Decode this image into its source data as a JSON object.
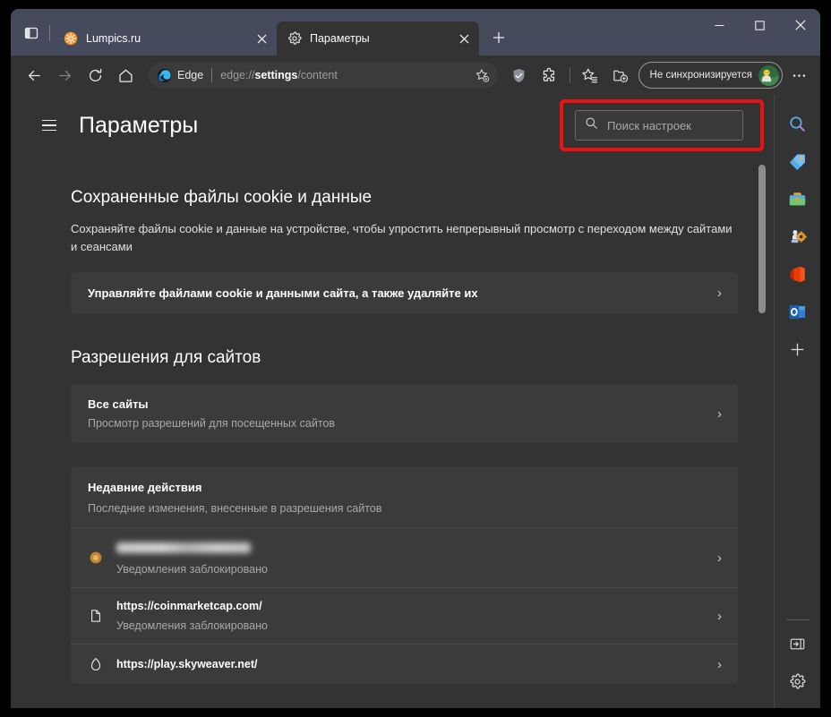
{
  "window": {
    "controls": {
      "minimize": "—",
      "maximize": "☐",
      "close": "✕"
    },
    "tab_actions_label": "Действия с вкладками",
    "new_tab_label": "Новая вкладка"
  },
  "tabs": [
    {
      "title": "Lumpics.ru",
      "favicon": "orange-flower-icon",
      "active": false,
      "close_label": "✕"
    },
    {
      "title": "Параметры",
      "favicon": "gear-icon",
      "active": true,
      "close_label": "✕"
    }
  ],
  "toolbar": {
    "back_label": "Назад",
    "forward_label": "Вперед",
    "refresh_label": "Обновить",
    "home_label": "Главная",
    "address": {
      "brand": "Edge",
      "url_prefix": "edge://",
      "url_bold": "settings",
      "url_suffix": "/content",
      "favorite_label": "Добавить в избранное"
    },
    "shield_label": "Безопасность",
    "extensions_label": "Расширения",
    "favorites_label": "Избранное",
    "collections_label": "Коллекции",
    "profile": {
      "label": "Не синхронизируется",
      "avatar": "user-avatar"
    },
    "more_label": "Параметры и другое"
  },
  "settings": {
    "title": "Параметры",
    "menu_label": "Меню параметров",
    "search": {
      "placeholder": "Поиск настроек",
      "value": "",
      "icon": "search-icon"
    },
    "sections": [
      {
        "id": "cookies",
        "title": "Сохраненные файлы cookie и данные",
        "description": "Сохраняйте файлы cookie и данные на устройстве, чтобы упростить непрерывный просмотр с переходом между сайтами и сеансами",
        "rows": [
          {
            "title": "Управляйте файлами cookie и данными сайта, а также удаляйте их",
            "chevron": "›"
          }
        ]
      },
      {
        "id": "permissions",
        "title": "Разрешения для сайтов",
        "rows": [
          {
            "title": "Все сайты",
            "subtitle": "Просмотр разрешений для посещенных сайтов",
            "chevron": "›"
          }
        ]
      }
    ],
    "recent": {
      "title": "Недавние действия",
      "subtitle": "Последние изменения, внесенные в разрешения сайтов",
      "items": [
        {
          "url": "",
          "blurred": true,
          "status": "Уведомления заблокировано",
          "icon": "globe-orange-icon",
          "chevron": "›"
        },
        {
          "url": "https://coinmarketcap.com/",
          "blurred": false,
          "status": "Уведомления заблокировано",
          "icon": "page-icon",
          "chevron": "›"
        },
        {
          "url": "https://play.skyweaver.net/",
          "blurred": false,
          "status": "",
          "icon": "flame-icon",
          "chevron": "›"
        }
      ]
    }
  },
  "rail": {
    "items": [
      {
        "name": "search-icon",
        "label": "Поиск"
      },
      {
        "name": "tag-icon",
        "label": "Покупки"
      },
      {
        "name": "tools-icon",
        "label": "Инструменты"
      },
      {
        "name": "games-icon",
        "label": "Игры"
      },
      {
        "name": "office-icon",
        "label": "Office"
      },
      {
        "name": "outlook-icon",
        "label": "Outlook"
      },
      {
        "name": "plus-icon",
        "label": "Настроить"
      }
    ],
    "bottom": [
      {
        "name": "panel-toggle-icon",
        "label": "Закрыть панель"
      },
      {
        "name": "gear-icon",
        "label": "Параметры боковой панели"
      }
    ]
  },
  "annotation": {
    "color": "#ee1111",
    "target": "search-settings-box"
  }
}
